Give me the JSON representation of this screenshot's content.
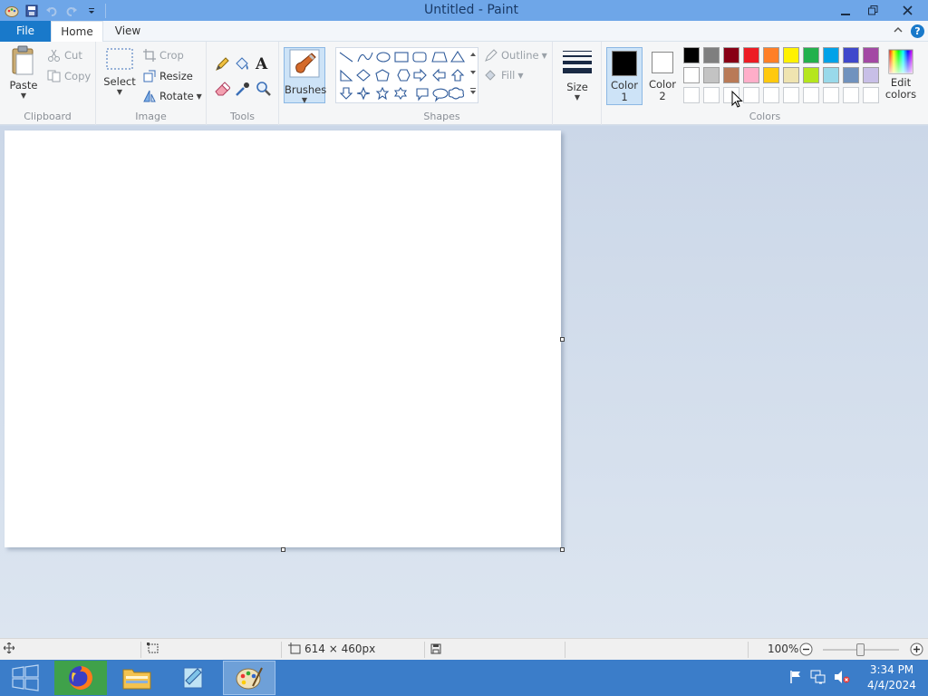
{
  "titlebar": {
    "title": "Untitled - Paint"
  },
  "tabs": {
    "file": "File",
    "home": "Home",
    "view": "View",
    "help": "?"
  },
  "clipboard": {
    "paste": "Paste",
    "cut": "Cut",
    "copy": "Copy",
    "label": "Clipboard"
  },
  "image": {
    "select": "Select",
    "crop": "Crop",
    "resize": "Resize",
    "rotate": "Rotate",
    "label": "Image"
  },
  "tools": {
    "label": "Tools",
    "text_tool": "A"
  },
  "brushes": {
    "label": "Brushes"
  },
  "shapes": {
    "outline": "Outline",
    "fill": "Fill",
    "label": "Shapes"
  },
  "size": {
    "label": "Size"
  },
  "colors": {
    "color1_line1": "Color",
    "color1_line2": "1",
    "color2_line1": "Color",
    "color2_line2": "2",
    "edit_line1": "Edit",
    "edit_line2": "colors",
    "label": "Colors",
    "color1_value": "#000000",
    "color2_value": "#ffffff",
    "row1": [
      "#000000",
      "#7f7f7f",
      "#880015",
      "#ed1c24",
      "#ff7f27",
      "#fff200",
      "#22b14c",
      "#00a2e8",
      "#3f48cc",
      "#a349a4"
    ],
    "row2": [
      "#ffffff",
      "#c3c3c3",
      "#b97a57",
      "#ffaec9",
      "#ffc90e",
      "#efe4b0",
      "#b5e61d",
      "#99d9ea",
      "#7092be",
      "#c8bfe7"
    ]
  },
  "status": {
    "dimensions": "614 × 460px",
    "zoom": "100%"
  },
  "taskbar": {
    "time": "3:34 PM",
    "date": "4/4/2024"
  }
}
